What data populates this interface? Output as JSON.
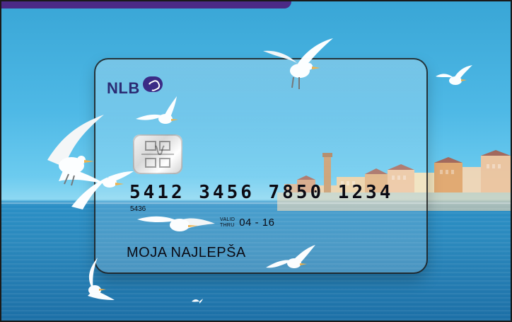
{
  "card": {
    "brand": "NLB",
    "number": "5412 3456 7850 1234",
    "small_number": "5436",
    "valid_label_top": "VALID",
    "valid_label_bottom": "THRU",
    "valid_date": "04 - 16",
    "cardholder": "MOJA NAJLEPŠA"
  },
  "colors": {
    "brand_text": "#2b2c74",
    "brand_mark": "#3b2b86",
    "top_tab": "#4b2a86"
  },
  "icons": {
    "chip": "emv-chip-icon",
    "brand_mark": "nlb-logo-mark-icon",
    "gull": "seagull-icon"
  }
}
